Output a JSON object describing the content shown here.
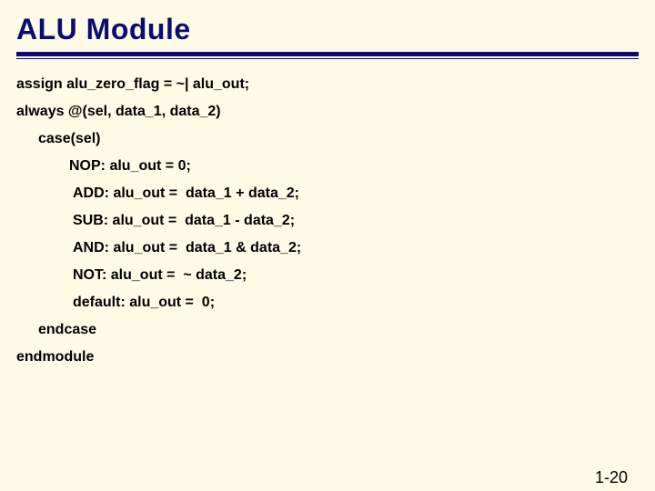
{
  "title": "ALU Module",
  "code": {
    "l1": "assign alu_zero_flag = ~| alu_out;",
    "l2": "always @(sel, data_1, data_2)",
    "l3": "case(sel)",
    "l4": "NOP: alu_out = 0;",
    "l5": "ADD: alu_out =  data_1 + data_2;",
    "l6": "SUB: alu_out =  data_1 - data_2;",
    "l7": "AND: alu_out =  data_1 & data_2;",
    "l8": "NOT: alu_out =  ~ data_2;",
    "l9": "default: alu_out =  0;",
    "l10": "endcase",
    "l11": "endmodule"
  },
  "footer": "1-20"
}
